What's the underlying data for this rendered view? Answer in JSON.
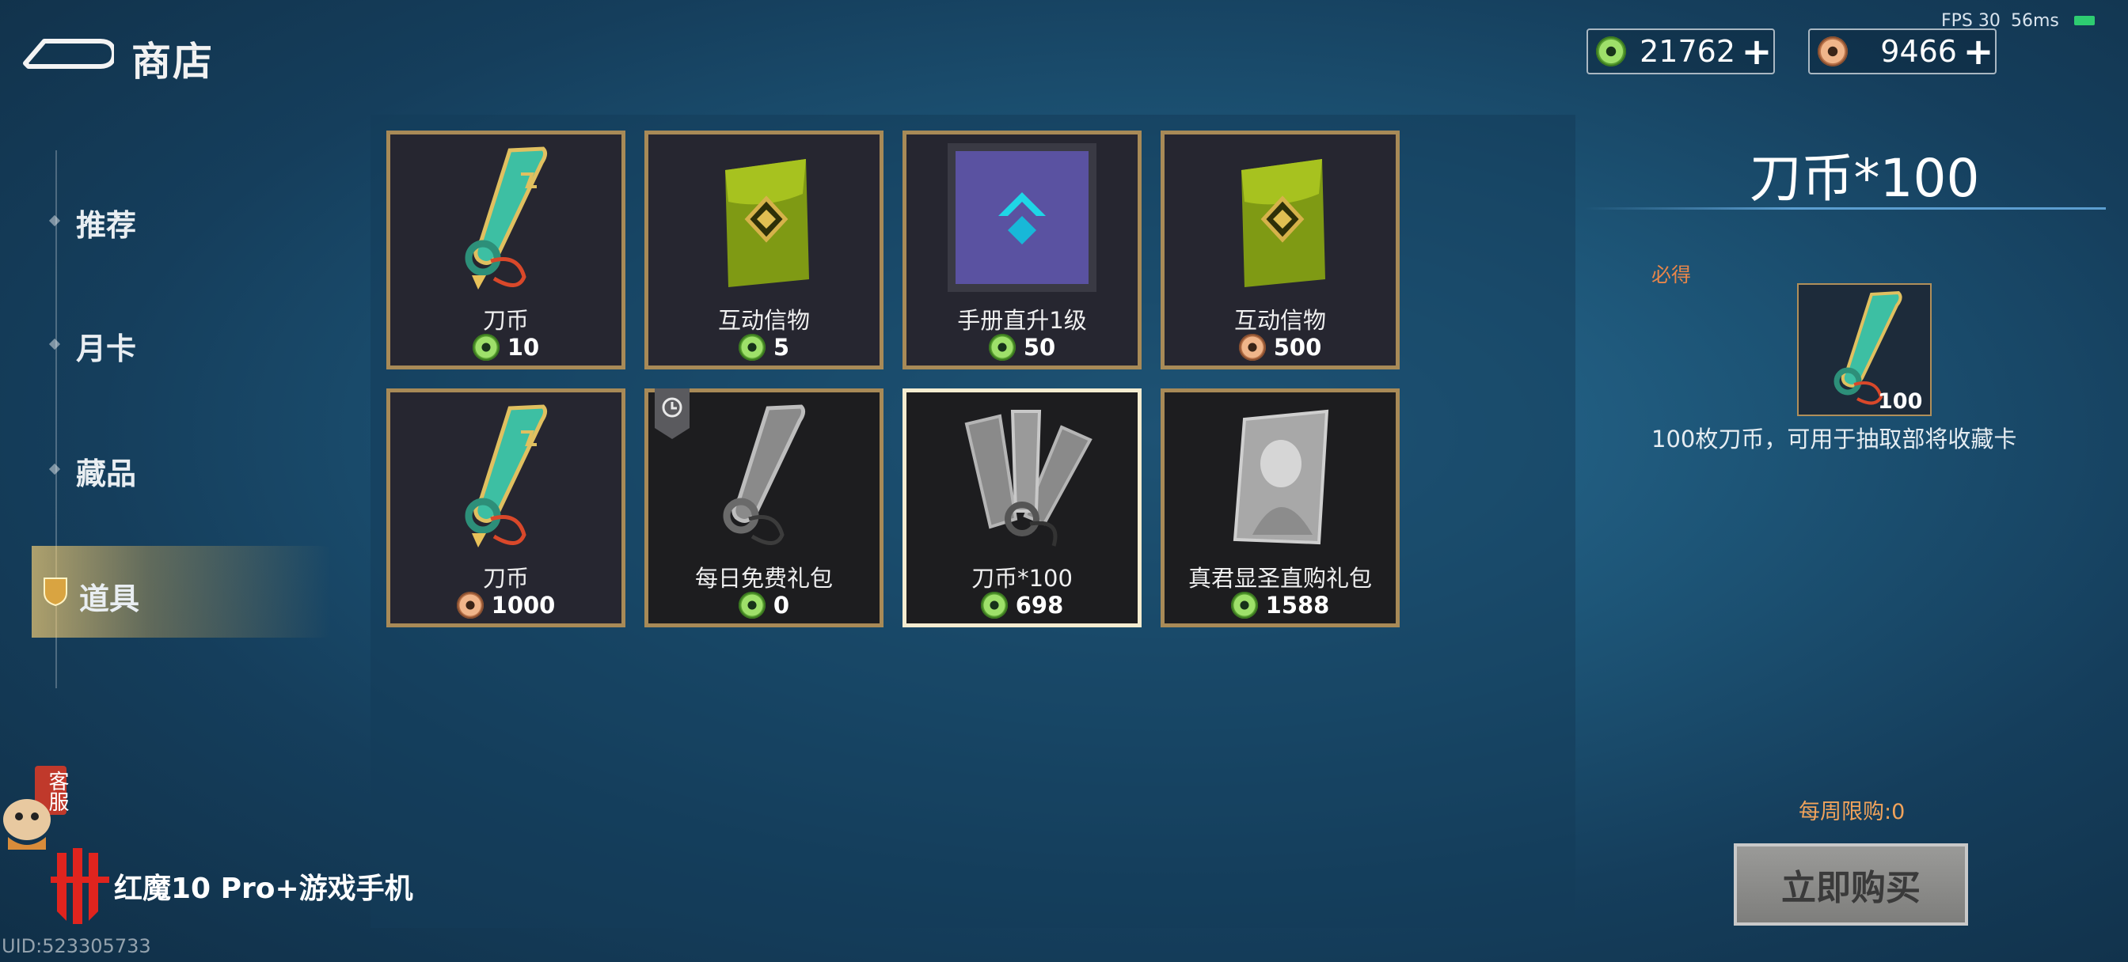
{
  "header": {
    "title": "商店",
    "fps": "FPS 30",
    "ping": "56ms"
  },
  "currencies": [
    {
      "icon": "jade-coin-icon",
      "value": "21762"
    },
    {
      "icon": "copper-coin-icon",
      "value": "9466"
    }
  ],
  "sidebar": {
    "items": [
      {
        "label": "推荐",
        "active": false
      },
      {
        "label": "月卡",
        "active": false
      },
      {
        "label": "藏品",
        "active": false
      },
      {
        "label": "道具",
        "active": true
      }
    ]
  },
  "shop": {
    "items": [
      {
        "name": "刀币",
        "price": "10",
        "currency": "jade",
        "art": "blade-coin-icon"
      },
      {
        "name": "互动信物",
        "price": "5",
        "currency": "jade",
        "art": "green-envelope-icon"
      },
      {
        "name": "手册直升1级",
        "price": "50",
        "currency": "jade",
        "art": "level-up-icon"
      },
      {
        "name": "互动信物",
        "price": "500",
        "currency": "copper",
        "art": "green-envelope-icon"
      },
      {
        "name": "刀币",
        "price": "1000",
        "currency": "copper",
        "art": "blade-coin-icon"
      },
      {
        "name": "每日免费礼包",
        "price": "0",
        "currency": "jade",
        "art": "grey-blade-coin-icon"
      },
      {
        "name": "刀币*100",
        "price": "698",
        "currency": "jade",
        "art": "grey-blade-bundle-icon"
      },
      {
        "name": "真君显圣直购礼包",
        "price": "1588",
        "currency": "jade",
        "art": "grey-card-icon"
      }
    ],
    "selected_index": 6
  },
  "detail": {
    "title": "刀币*100",
    "must_get_label": "必得",
    "item_count": "100",
    "description": "100枚刀币，可用于抽取部将收藏卡",
    "weekly_limit": "每周限购:0",
    "buy_label": "立即购买"
  },
  "footer": {
    "brand": "红魔10 Pro+游戏手机",
    "uid": "UID:523305733",
    "support_label": "客服"
  },
  "colors": {
    "card_border": "#a88a57",
    "selected_border": "#f4ecd0",
    "accent_orange": "#e8864a"
  }
}
